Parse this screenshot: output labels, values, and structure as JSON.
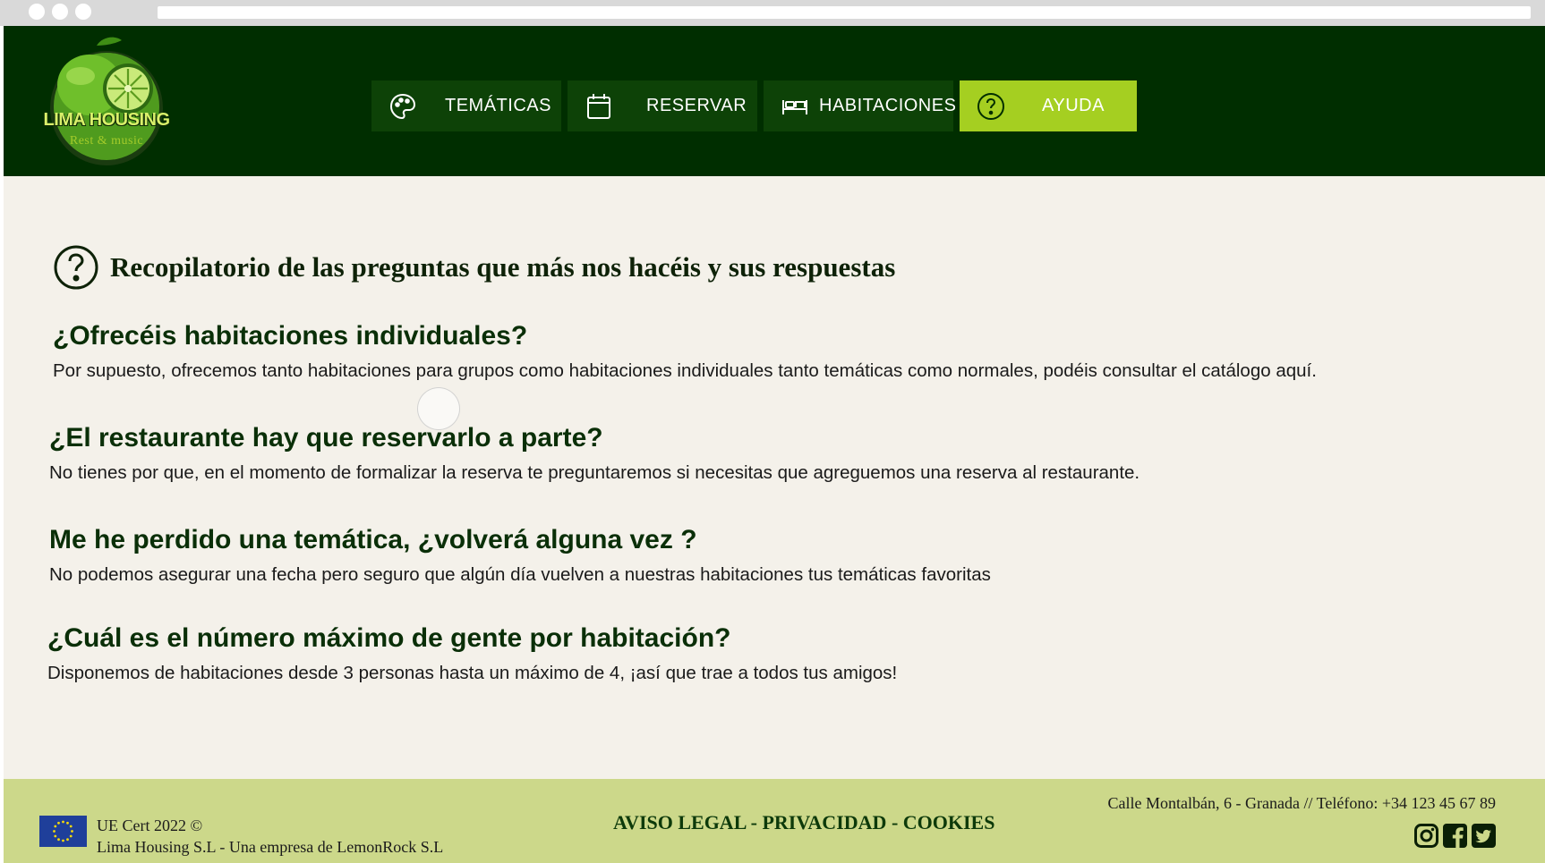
{
  "brand": {
    "name": "LIMA HOUSING",
    "tagline": "Rest & music",
    "colors": {
      "header": "#002e00",
      "nav": "#0d4207",
      "active": "#a5cf21",
      "footer": "#ccd88a",
      "page": "#f4f1ea"
    }
  },
  "nav": [
    {
      "label": "TEMÁTICAS",
      "icon": "palette-icon",
      "active": false
    },
    {
      "label": "RESERVAR",
      "icon": "calendar-icon",
      "active": false
    },
    {
      "label": "HABITACIONES",
      "icon": "bed-icon",
      "active": false
    },
    {
      "label": "AYUDA",
      "icon": "help-circle-icon",
      "active": true
    }
  ],
  "faq": {
    "heading": "Recopilatorio de las preguntas que más nos hacéis y sus respuestas",
    "items": [
      {
        "q": "¿Ofrecéis habitaciones individuales?",
        "a": "Por supuesto, ofrecemos tanto habitaciones para grupos como habitaciones individuales tanto temáticas como normales, podéis consultar el catálogo aquí."
      },
      {
        "q": "¿El restaurante hay que reservarlo a parte?",
        "a": "No tienes por que, en el momento de formalizar la reserva te preguntaremos si necesitas que agreguemos una reserva al restaurante."
      },
      {
        "q": "Me he perdido una temática, ¿volverá alguna vez ?",
        "a": "No podemos asegurar una fecha pero seguro que algún día vuelven a nuestras habitaciones tus temáticas favoritas"
      },
      {
        "q": "¿Cuál es el número máximo de gente por habitación?",
        "a": "Disponemos de habitaciones desde 3 personas hasta un máximo de 4, ¡así que trae a todos tus amigos!"
      }
    ]
  },
  "footer": {
    "cert_line1": "UE Cert 2022 ©",
    "cert_line2": "Lima Housing S.L - Una empresa de LemonRock S.L",
    "legal_aviso": "AVISO LEGAL",
    "legal_privacidad": "PRIVACIDAD",
    "legal_cookies": "COOKIES",
    "separator": " - ",
    "contact": "Calle Montalbán, 6 - Granada  // Teléfono: +34 123 45 67 89",
    "socials": [
      "instagram-icon",
      "facebook-icon",
      "twitter-icon"
    ]
  }
}
